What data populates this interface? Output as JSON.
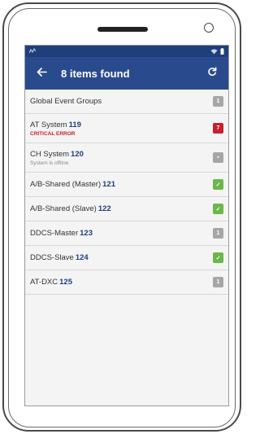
{
  "status_bar": {
    "left_icon": "signal-activity-icon",
    "right_icons": [
      "wifi-icon",
      "battery-icon"
    ]
  },
  "app_bar": {
    "title": "8 items found",
    "back_icon": "arrow-left-icon",
    "refresh_icon": "refresh-icon"
  },
  "colors": {
    "app_bar": "#2a4a8e",
    "status_bar": "#1f3f7a",
    "badge_gray": "#a6a6a6",
    "badge_red": "#c8202a",
    "badge_green": "#6cb64a",
    "error_text": "#c8202a"
  },
  "items": [
    {
      "name": "Global Event Groups",
      "number": "",
      "sub": "",
      "sub_type": "",
      "badge": "1",
      "badge_color": "#a6a6a6"
    },
    {
      "name": "AT System",
      "number": "119",
      "sub": "CRITICAL ERROR",
      "sub_type": "error",
      "badge": "7",
      "badge_color": "#c8202a"
    },
    {
      "name": "CH System",
      "number": "120",
      "sub": "System is offline",
      "sub_type": "muted",
      "badge": "▪",
      "badge_color": "#a6a6a6"
    },
    {
      "name": "A/B-Shared (Master)",
      "number": "121",
      "sub": "",
      "sub_type": "",
      "badge": "✓",
      "badge_color": "#6cb64a"
    },
    {
      "name": "A/B-Shared (Slave)",
      "number": "122",
      "sub": "",
      "sub_type": "",
      "badge": "✓",
      "badge_color": "#6cb64a"
    },
    {
      "name": "DDCS-Master",
      "number": "123",
      "sub": "",
      "sub_type": "",
      "badge": "1",
      "badge_color": "#a6a6a6"
    },
    {
      "name": "DDCS-Slave",
      "number": "124",
      "sub": "",
      "sub_type": "",
      "badge": "✓",
      "badge_color": "#6cb64a"
    },
    {
      "name": "AT-DXC",
      "number": "125",
      "sub": "",
      "sub_type": "",
      "badge": "1",
      "badge_color": "#a6a6a6"
    }
  ]
}
